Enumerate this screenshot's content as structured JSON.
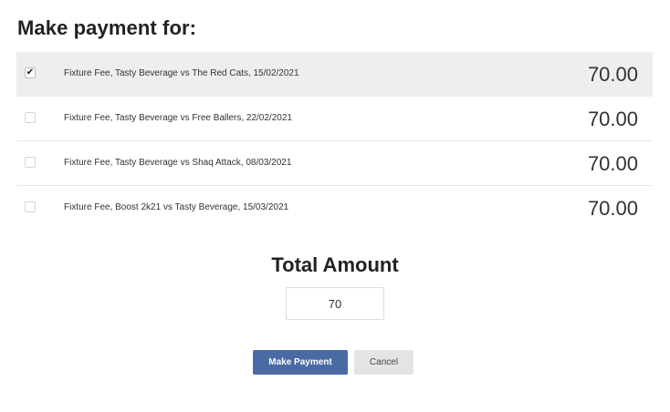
{
  "header": {
    "title": "Make payment for:"
  },
  "fees": [
    {
      "description": "Fixture Fee, Tasty Beverage vs The Red Cats, 15/02/2021",
      "amount": "70.00",
      "checked": true,
      "checkmark": "✔"
    },
    {
      "description": "Fixture Fee, Tasty Beverage vs Free Ballers, 22/02/2021",
      "amount": "70.00",
      "checked": false,
      "checkmark": ""
    },
    {
      "description": "Fixture Fee, Tasty Beverage vs Shaq Attack, 08/03/2021",
      "amount": "70.00",
      "checked": false,
      "checkmark": ""
    },
    {
      "description": "Fixture Fee, Boost 2k21 vs Tasty Beverage, 15/03/2021",
      "amount": "70.00",
      "checked": false,
      "checkmark": ""
    }
  ],
  "total": {
    "label": "Total Amount",
    "value": "70"
  },
  "actions": {
    "make_payment_label": "Make Payment",
    "cancel_label": "Cancel"
  },
  "colors": {
    "primary_button": "#4a6aa5",
    "secondary_button": "#e4e4e4",
    "selected_row": "#eeeeee"
  }
}
